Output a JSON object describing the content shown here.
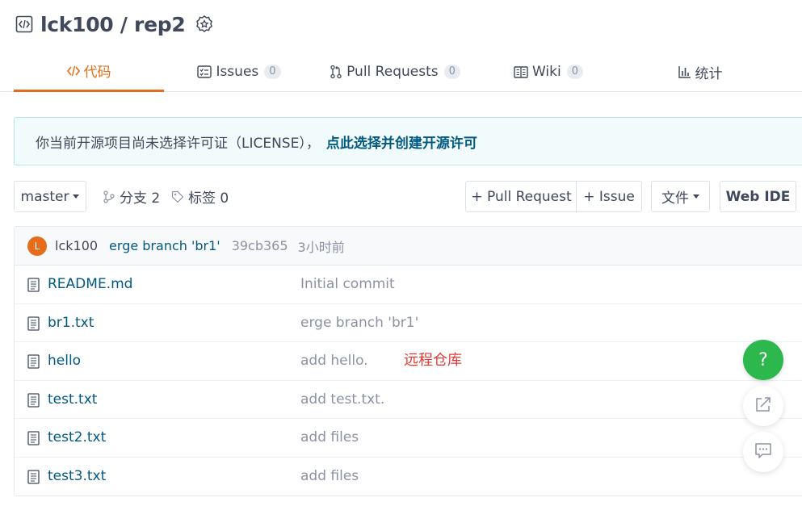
{
  "repo": {
    "title": "lck100 / rep2",
    "icon": "code-repo-icon",
    "badge_icon": "award-badge-icon"
  },
  "tabs": [
    {
      "label": "代码",
      "icon": "code-icon",
      "count": "",
      "active": true
    },
    {
      "label": "Issues",
      "icon": "issues-icon",
      "count": "0",
      "active": false
    },
    {
      "label": "Pull Requests",
      "icon": "pull-request-icon",
      "count": "0",
      "active": false
    },
    {
      "label": "Wiki",
      "icon": "wiki-icon",
      "count": "0",
      "active": false
    },
    {
      "label": "统计",
      "icon": "stats-icon",
      "count": "",
      "active": false
    }
  ],
  "license_notice": {
    "text": "你当前开源项目尚未选择许可证（LICENSE），",
    "link": "点此选择并创建开源许可"
  },
  "toolbar": {
    "branch": "master",
    "branches": "分支 2",
    "tags": "标签 0",
    "pull_request": "+ Pull Request",
    "issue": "+ Issue",
    "file_menu": "文件",
    "web_ide": "Web IDE"
  },
  "latest_commit": {
    "avatar_letter": "L",
    "author": "lck100",
    "message": "erge branch 'br1'",
    "sha": "39cb365",
    "time": "3小时前"
  },
  "files": [
    {
      "name": "README.md",
      "commit": "Initial commit"
    },
    {
      "name": "br1.txt",
      "commit": "erge branch 'br1'"
    },
    {
      "name": "hello",
      "commit": "add hello."
    },
    {
      "name": "test.txt",
      "commit": "add test.txt."
    },
    {
      "name": "test2.txt",
      "commit": "add files"
    },
    {
      "name": "test3.txt",
      "commit": "add files"
    }
  ],
  "annotation": "远程仓库",
  "floating": {
    "help_label": "?",
    "share_icon": "share-icon",
    "chat_icon": "chat-icon"
  },
  "colors": {
    "accent": "#e46c1a",
    "link": "#005980",
    "help_green": "#2db84d",
    "annotation_red": "#e53935"
  }
}
